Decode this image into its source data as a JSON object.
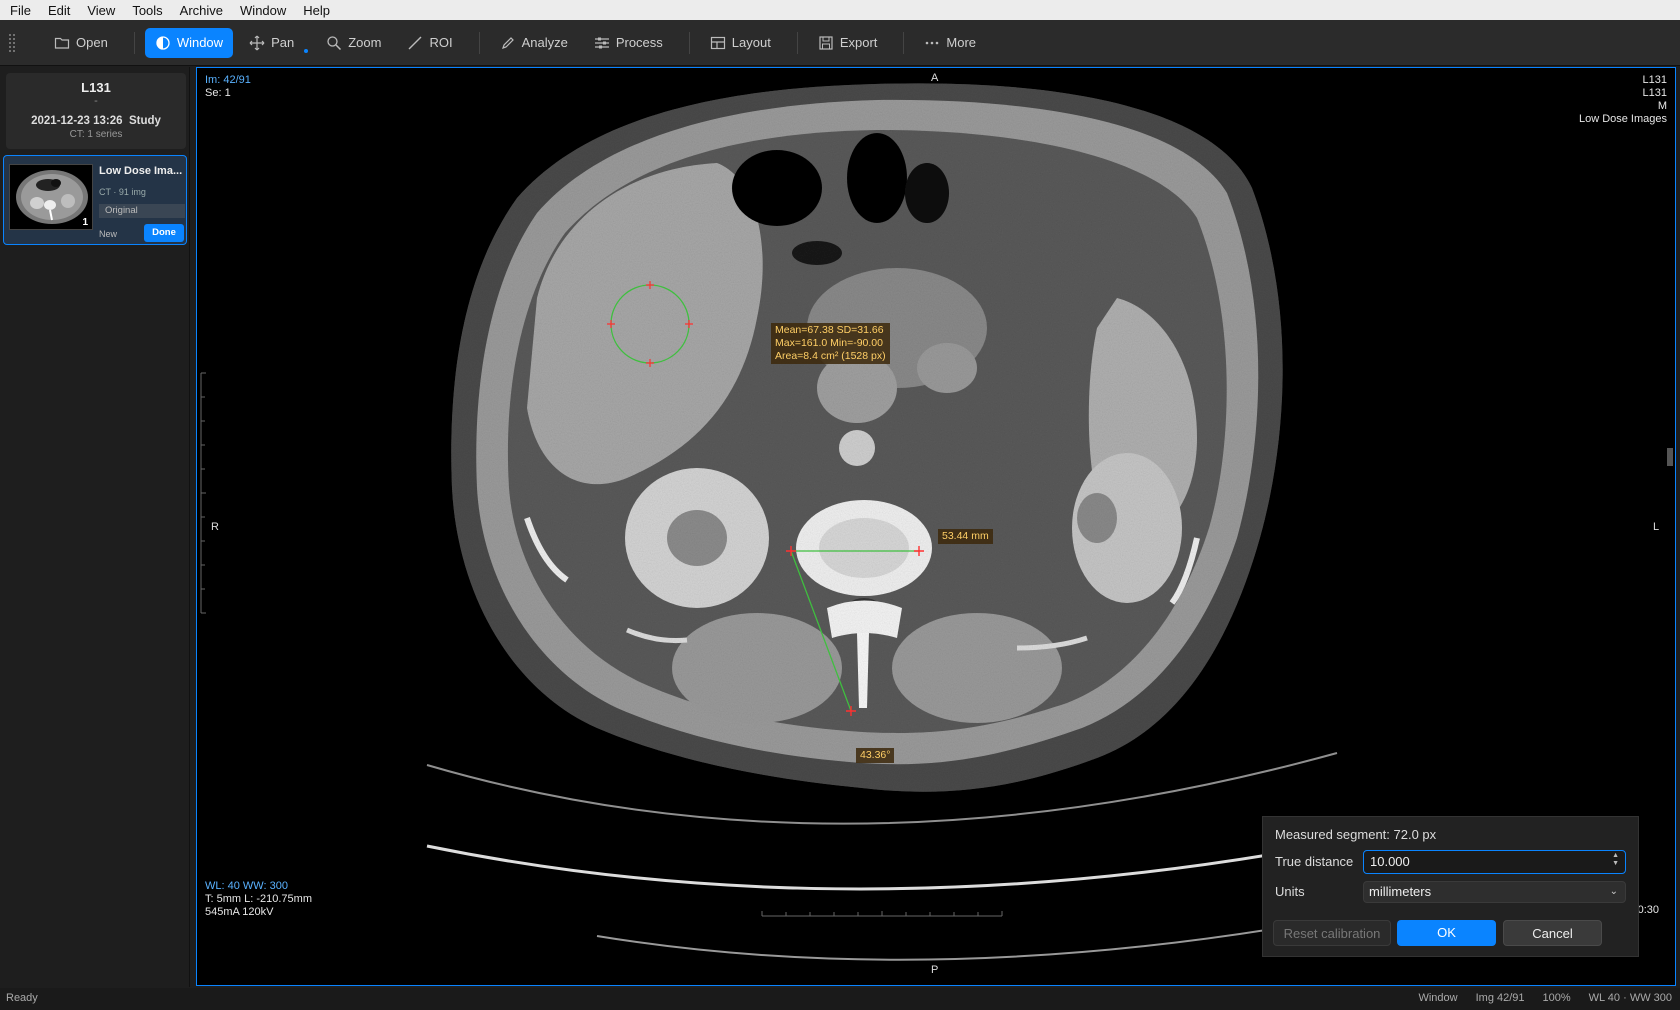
{
  "menu": [
    "File",
    "Edit",
    "View",
    "Tools",
    "Archive",
    "Window",
    "Help"
  ],
  "toolbar": {
    "open": "Open",
    "window": "Window",
    "pan": "Pan",
    "zoom": "Zoom",
    "roi": "ROI",
    "analyze": "Analyze",
    "process": "Process",
    "layout": "Layout",
    "export": "Export",
    "more": "More"
  },
  "sidebar": {
    "study": {
      "patient_id": "L131",
      "dash": "-",
      "datetime": "2021-12-23 13:26",
      "label": "Study",
      "series_count": "CT: 1 series"
    },
    "series": {
      "name": "Low Dose Ima...",
      "meta": "CT · 91 img",
      "tag": "Original",
      "thumb_number": "1",
      "new_label": "New",
      "done_label": "Done"
    }
  },
  "viewer": {
    "image_index": "Im: 42/91",
    "series": "Se: 1",
    "top_right": [
      "L131",
      "L131",
      "M",
      "Low Dose Images"
    ],
    "orient": {
      "top": "A",
      "bottom": "P",
      "left": "R",
      "right": "L"
    },
    "window_level": "WL: 40 WW: 300",
    "thickness": "T: 5mm L: -210.75mm",
    "exposure": "545mA 120kV",
    "timestamp": "2021-12-22 13:30:30",
    "roi_stats": [
      "Mean=67.38 SD=31.66",
      "Max=161.0 Min=-90.00",
      "Area=8.4 cm² (1528 px)"
    ],
    "distance_label": "53.44 mm",
    "angle_label": "43.36°"
  },
  "calibration": {
    "measured": "Measured segment: 72.0 px",
    "true_distance_label": "True distance",
    "true_distance_value": "10.000",
    "units_label": "Units",
    "units_value": "millimeters",
    "reset": "Reset calibration",
    "ok": "OK",
    "cancel": "Cancel"
  },
  "status": {
    "left": "Ready",
    "tool": "Window",
    "image": "Img 42/91",
    "zoom": "100%",
    "wl": "WL 40 · WW 300"
  },
  "colors": {
    "accent": "#0a84ff",
    "annotation_line": "#3fbf3f",
    "annotation_point": "#ff3030",
    "label_text": "#ffcf66"
  }
}
